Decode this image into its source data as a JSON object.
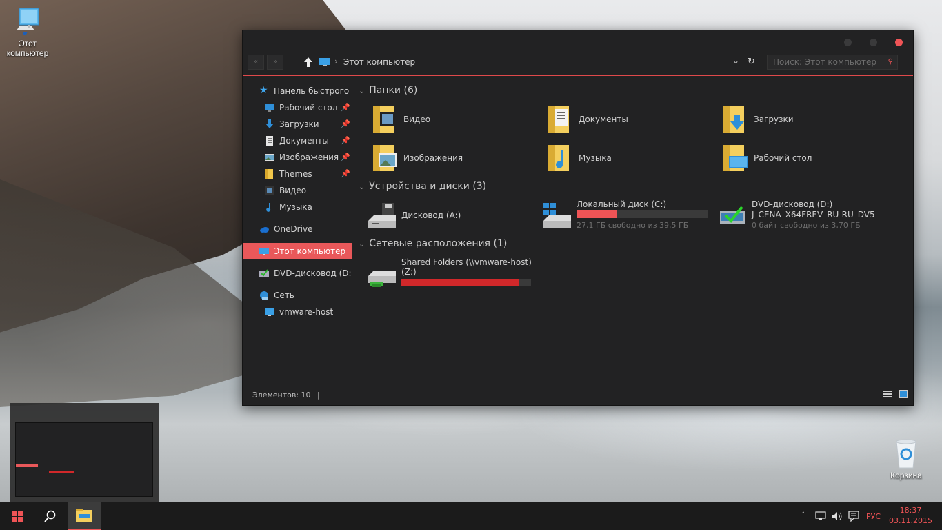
{
  "desktop": {
    "this_pc_label": "Этот компьютер",
    "recycle_label": "Корзина"
  },
  "window": {
    "address_path": "Этот компьютер",
    "search_placeholder": "Поиск: Этот компьютер",
    "status": "Элементов: 10"
  },
  "nav": {
    "quick_access": "Панель быстрого доступа",
    "items": [
      {
        "label": "Рабочий стол",
        "icon": "desktop-icon",
        "pinned": true
      },
      {
        "label": "Загрузки",
        "icon": "download-arrow-icon",
        "pinned": true
      },
      {
        "label": "Документы",
        "icon": "document-icon",
        "pinned": true
      },
      {
        "label": "Изображения",
        "icon": "pictures-icon",
        "pinned": true
      },
      {
        "label": "Themes",
        "icon": "folder-icon",
        "pinned": true
      },
      {
        "label": "Видео",
        "icon": "video-icon",
        "pinned": false
      },
      {
        "label": "Музыка",
        "icon": "music-note-icon",
        "pinned": false
      }
    ],
    "onedrive": "OneDrive",
    "this_pc": "Этот компьютер",
    "dvd": "DVD-дисковод (D:) J_",
    "network": "Сеть",
    "vmware": "vmware-host"
  },
  "content": {
    "folders_header": "Папки (6)",
    "folders": [
      {
        "label": "Видео",
        "icon": "video-folder-icon"
      },
      {
        "label": "Документы",
        "icon": "documents-folder-icon"
      },
      {
        "label": "Загрузки",
        "icon": "downloads-folder-icon"
      },
      {
        "label": "Изображения",
        "icon": "pictures-folder-icon"
      },
      {
        "label": "Музыка",
        "icon": "music-folder-icon"
      },
      {
        "label": "Рабочий стол",
        "icon": "desktop-folder-icon"
      }
    ],
    "devices_header": "Устройства и диски (3)",
    "floppy": "Дисковод (A:)",
    "local_disk": {
      "label": "Локальный диск (C:)",
      "free": "27,1 ГБ свободно из 39,5 ГБ",
      "used_fraction": 0.31
    },
    "dvd": {
      "label": "DVD-дисковод (D:)",
      "label2": "J_CENA_X64FREV_RU-RU_DV5",
      "free": "0 байт свободно из 3,70 ГБ"
    },
    "network_header": "Сетевые расположения (1)",
    "shared": {
      "label": "Shared Folders (\\\\vmware-host)",
      "label2": "(Z:)",
      "used_fraction": 0.91
    }
  },
  "taskbar": {
    "lang": "РУС",
    "time": "18:37",
    "date": "03.11.2015"
  },
  "colors": {
    "accent": "#ef5456",
    "window_bg": "#222223",
    "taskbar_bg": "#1b1b1b"
  }
}
